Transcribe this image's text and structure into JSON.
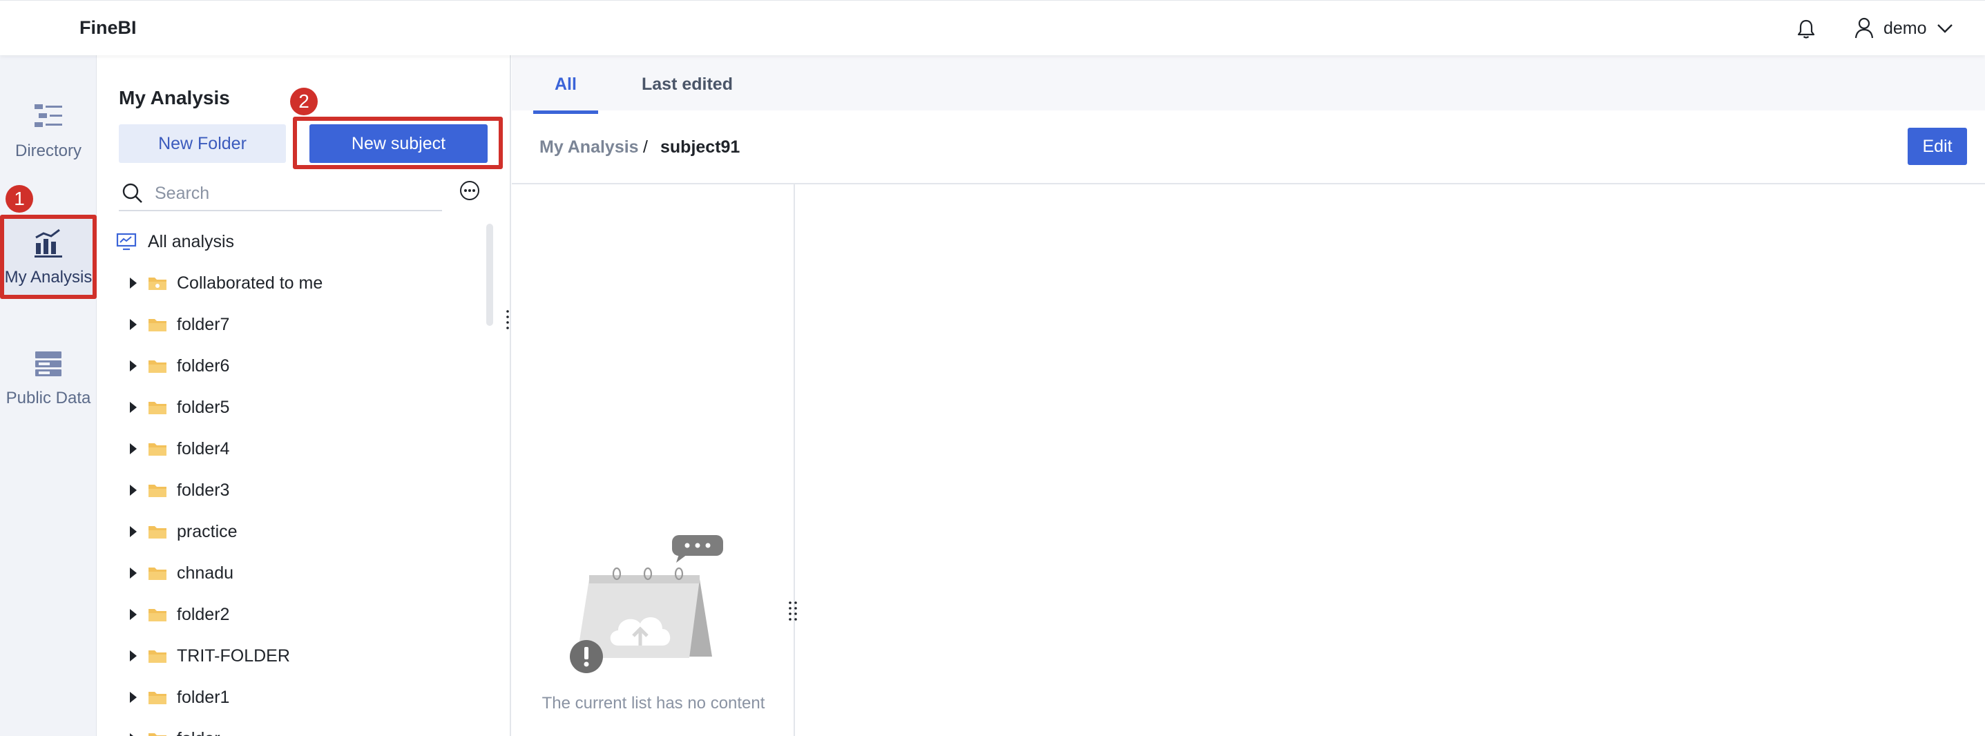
{
  "app": {
    "brand": "FineBI"
  },
  "header": {
    "user_name": "demo",
    "icons": [
      "bell-icon",
      "user-icon",
      "chevron-down-icon"
    ]
  },
  "rail": {
    "items": [
      {
        "label": "Directory",
        "icon": "directory-icon",
        "active": false
      },
      {
        "label": "My Analysis",
        "icon": "analysis-chart-icon",
        "active": true
      },
      {
        "label": "Public Data",
        "icon": "database-icon",
        "active": false
      }
    ]
  },
  "panel": {
    "title": "My Analysis",
    "new_folder_label": "New Folder",
    "new_subject_label": "New subject",
    "search_placeholder": "Search",
    "tree_root": "All analysis",
    "tree_items": [
      {
        "label": "Collaborated to me",
        "icon": "shared-folder-icon"
      },
      {
        "label": "folder7",
        "icon": "folder-icon"
      },
      {
        "label": "folder6",
        "icon": "folder-icon"
      },
      {
        "label": "folder5",
        "icon": "folder-icon"
      },
      {
        "label": "folder4",
        "icon": "folder-icon"
      },
      {
        "label": "folder3",
        "icon": "folder-icon"
      },
      {
        "label": "practice",
        "icon": "folder-icon"
      },
      {
        "label": "chnadu",
        "icon": "folder-icon"
      },
      {
        "label": "folder2",
        "icon": "folder-icon"
      },
      {
        "label": "TRIT-FOLDER",
        "icon": "folder-icon"
      },
      {
        "label": "folder1",
        "icon": "folder-icon"
      },
      {
        "label": "folder",
        "icon": "folder-icon"
      }
    ]
  },
  "content": {
    "tabs": [
      {
        "label": "All",
        "active": true
      },
      {
        "label": "Last edited",
        "active": false
      }
    ],
    "breadcrumb": {
      "root": "My Analysis",
      "separator": "/",
      "current": "subject91"
    },
    "edit_label": "Edit",
    "empty_message": "The current list has no content"
  },
  "annotations": [
    {
      "number": "1",
      "target": "My Analysis"
    },
    {
      "number": "2",
      "target": "New subject"
    }
  ],
  "colors": {
    "accent": "#3b64d8",
    "annotation": "#d0302a",
    "folder": "#f3c15a"
  }
}
